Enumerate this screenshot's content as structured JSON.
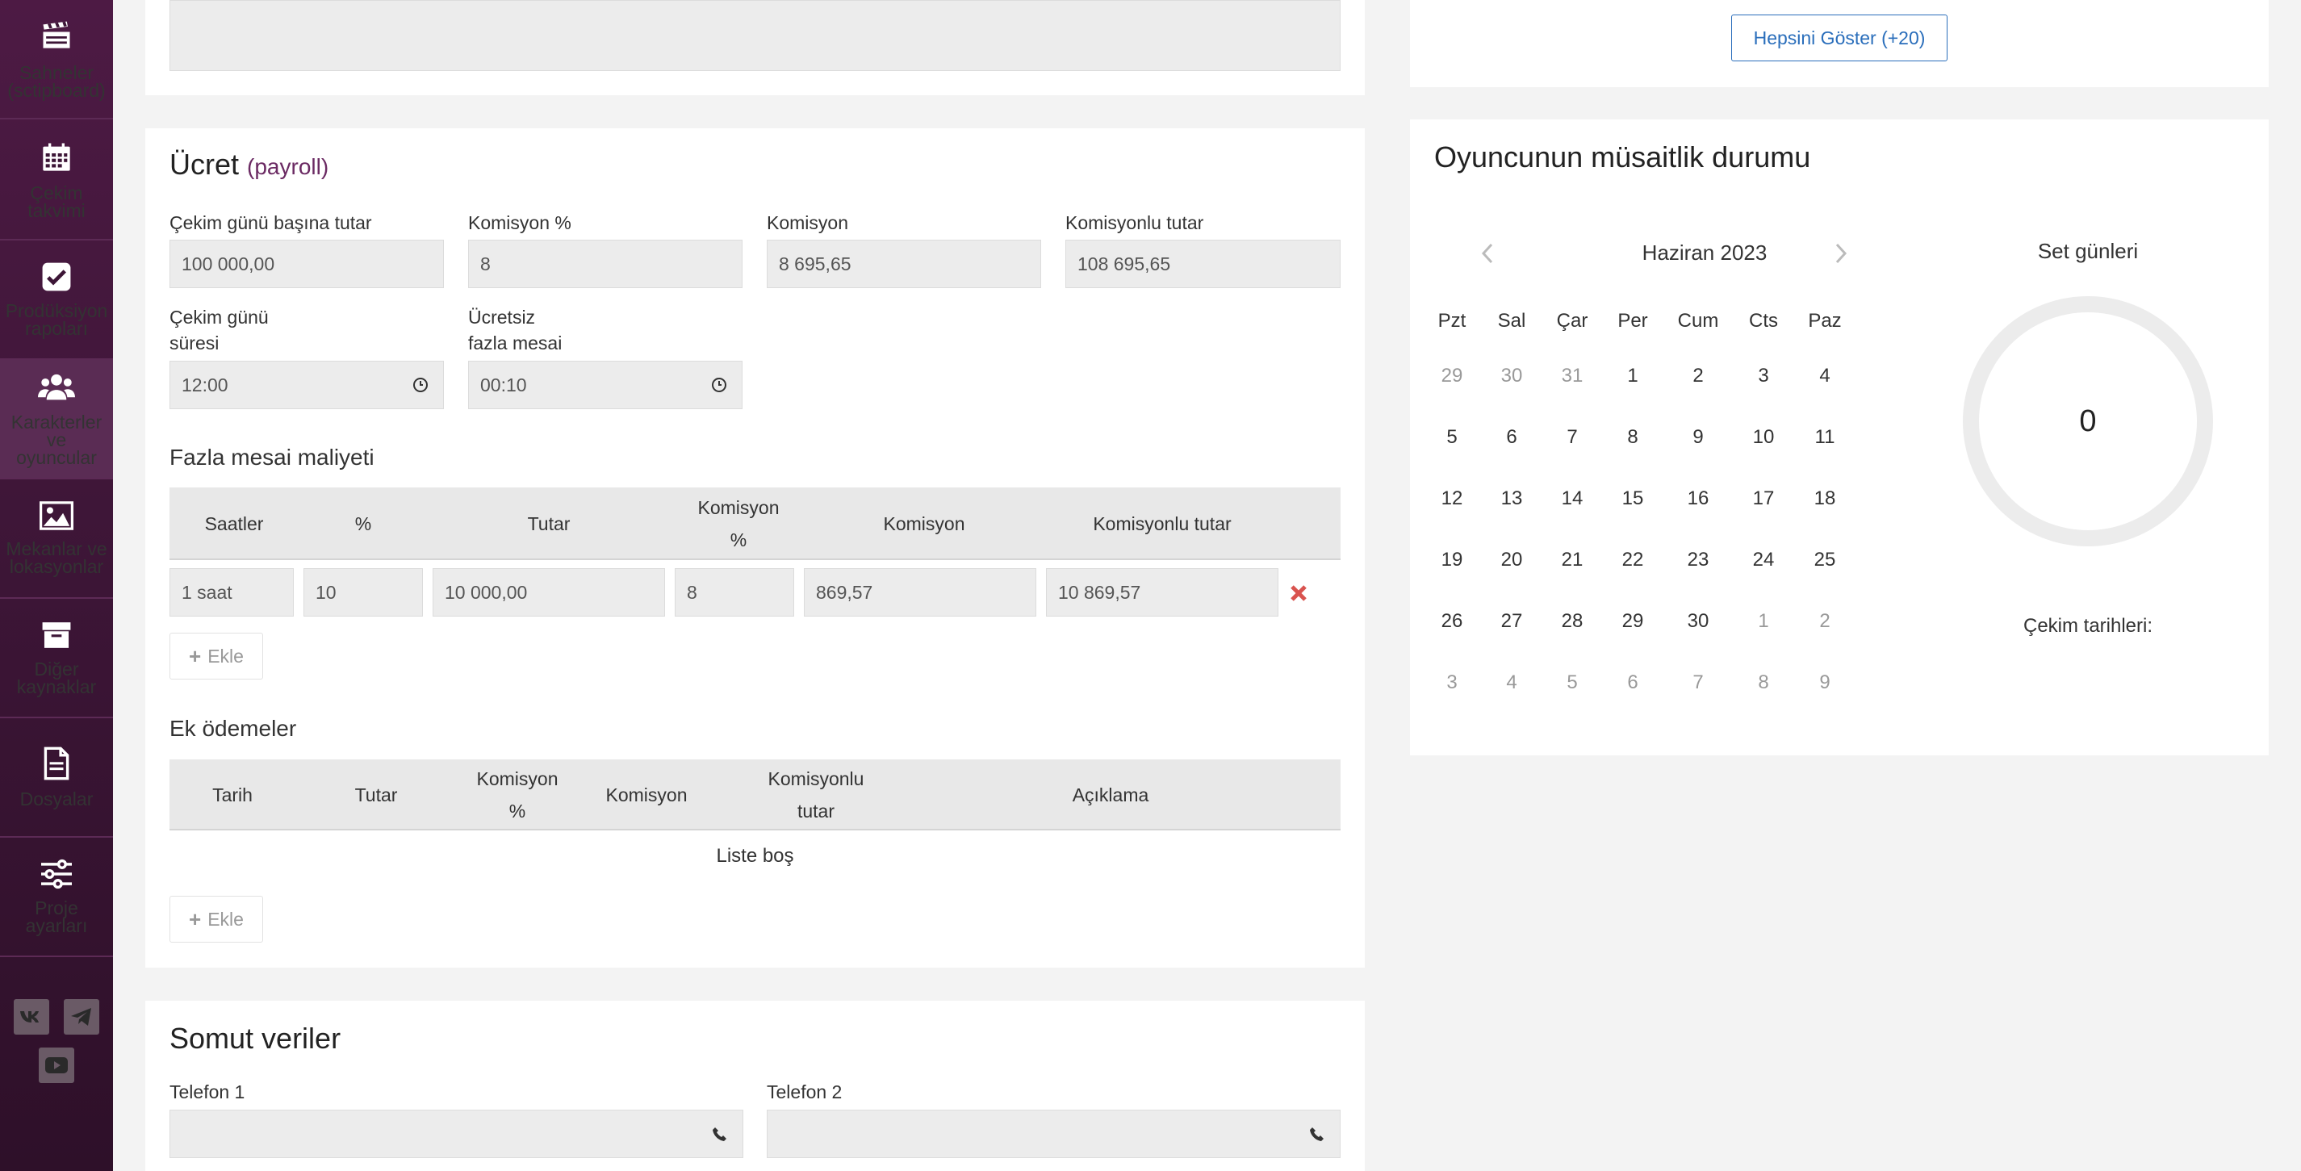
{
  "sidebar": {
    "items": [
      {
        "label": "Sahneler (sctipboard)",
        "icon": "clapperboard-icon"
      },
      {
        "label": "Çekim takvimi",
        "icon": "calendar-icon"
      },
      {
        "label": "Prodüksiyon rapoları",
        "icon": "checkbox-icon"
      },
      {
        "label": "Karakterler ve oyuncular",
        "icon": "users-icon"
      },
      {
        "label": "Mekanlar ve lokasyonlar",
        "icon": "image-icon"
      },
      {
        "label": "Diğer kaynaklar",
        "icon": "archive-icon"
      },
      {
        "label": "Dosyalar",
        "icon": "document-icon"
      },
      {
        "label": "Proje ayarları",
        "icon": "sliders-icon"
      }
    ],
    "social": [
      "vk-icon",
      "telegram-icon",
      "youtube-icon"
    ]
  },
  "payroll": {
    "title": "Ücret",
    "subtitle": "(payroll)",
    "fields": {
      "per_day_label": "Çekim günü başına tutar",
      "per_day_value": "100 000,00",
      "commission_pct_label": "Komisyon %",
      "commission_pct_value": "8",
      "commission_label": "Komisyon",
      "commission_value": "8 695,65",
      "total_label": "Komisyonlu tutar",
      "total_value": "108 695,65",
      "day_duration_label_1": "Çekim günü",
      "day_duration_label_2": "süresi",
      "day_duration_value": "12:00",
      "free_overtime_label_1": "Ücretsiz",
      "free_overtime_label_2": "fazla mesai",
      "free_overtime_value": "00:10"
    },
    "overtime": {
      "title": "Fazla mesai maliyeti",
      "headers": [
        "Saatler",
        "%",
        "Tutar",
        "Komisyon",
        "%",
        "Komisyon",
        "Komisyonlu tutar"
      ],
      "row": {
        "hours": "1 saat",
        "pct": "10",
        "amount": "10 000,00",
        "commission_pct": "8",
        "commission": "869,57",
        "total": "10 869,57"
      },
      "add_label": "Ekle"
    },
    "extra": {
      "title": "Ek ödemeler",
      "headers": [
        "Tarih",
        "Tutar",
        "Komisyon",
        "%",
        "Komisyon",
        "Komisyonlu",
        "tutar",
        "Açıklama"
      ],
      "empty": "Liste boş",
      "add_label": "Ekle"
    }
  },
  "concrete": {
    "title": "Somut veriler",
    "phone1_label": "Telefon 1",
    "phone2_label": "Telefon 2"
  },
  "top_right": {
    "show_all_label": "Hepsini Göster (+20)"
  },
  "availability": {
    "title": "Oyuncunun müsaitlik durumu",
    "month": "Haziran 2023",
    "weekdays": [
      "Pzt",
      "Sal",
      "Çar",
      "Per",
      "Cum",
      "Cts",
      "Paz"
    ],
    "weeks": [
      [
        {
          "d": "29",
          "dim": true
        },
        {
          "d": "30",
          "dim": true
        },
        {
          "d": "31",
          "dim": true
        },
        {
          "d": "1"
        },
        {
          "d": "2"
        },
        {
          "d": "3"
        },
        {
          "d": "4"
        }
      ],
      [
        {
          "d": "5"
        },
        {
          "d": "6"
        },
        {
          "d": "7"
        },
        {
          "d": "8"
        },
        {
          "d": "9"
        },
        {
          "d": "10"
        },
        {
          "d": "11"
        }
      ],
      [
        {
          "d": "12"
        },
        {
          "d": "13"
        },
        {
          "d": "14"
        },
        {
          "d": "15"
        },
        {
          "d": "16"
        },
        {
          "d": "17"
        },
        {
          "d": "18"
        }
      ],
      [
        {
          "d": "19"
        },
        {
          "d": "20"
        },
        {
          "d": "21"
        },
        {
          "d": "22"
        },
        {
          "d": "23"
        },
        {
          "d": "24"
        },
        {
          "d": "25"
        }
      ],
      [
        {
          "d": "26"
        },
        {
          "d": "27"
        },
        {
          "d": "28"
        },
        {
          "d": "29"
        },
        {
          "d": "30"
        },
        {
          "d": "1",
          "dim": true
        },
        {
          "d": "2",
          "dim": true
        }
      ],
      [
        {
          "d": "3",
          "dim": true
        },
        {
          "d": "4",
          "dim": true
        },
        {
          "d": "5",
          "dim": true
        },
        {
          "d": "6",
          "dim": true
        },
        {
          "d": "7",
          "dim": true
        },
        {
          "d": "8",
          "dim": true
        },
        {
          "d": "9",
          "dim": true
        }
      ]
    ],
    "set_days_label": "Set günleri",
    "set_days_value": "0",
    "shoot_dates_label": "Çekim tarihleri:"
  },
  "colors": {
    "sidebar_bg": "#3c1536",
    "accent": "#6b2a63",
    "link_blue": "#2a6ebb",
    "delete_red": "#d9534f"
  }
}
